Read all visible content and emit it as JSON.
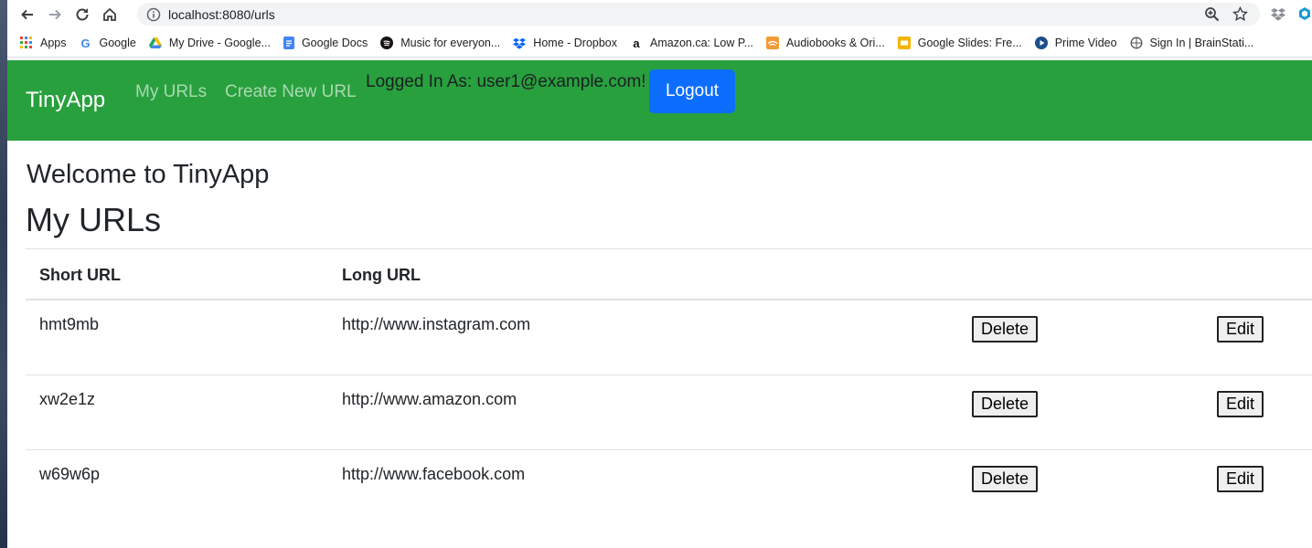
{
  "browser": {
    "url": "localhost:8080/urls",
    "bookmarks": [
      {
        "label": "Apps",
        "icon": "apps-grid-icon",
        "color": "#4285f4"
      },
      {
        "label": "Google",
        "icon": "google-icon",
        "color": "#4285f4"
      },
      {
        "label": "My Drive - Google...",
        "icon": "google-drive-icon",
        "color": "#1fa463"
      },
      {
        "label": "Google Docs",
        "icon": "google-docs-icon",
        "color": "#4285f4"
      },
      {
        "label": "Music for everyon...",
        "icon": "spotify-icon",
        "color": "#191414"
      },
      {
        "label": "Home - Dropbox",
        "icon": "dropbox-icon",
        "color": "#0061ff"
      },
      {
        "label": "Amazon.ca: Low P...",
        "icon": "amazon-icon",
        "color": "#111111"
      },
      {
        "label": "Audiobooks & Ori...",
        "icon": "audible-icon",
        "color": "#f29a36"
      },
      {
        "label": "Google Slides: Fre...",
        "icon": "google-slides-icon",
        "color": "#f4b400"
      },
      {
        "label": "Prime Video",
        "icon": "prime-video-icon",
        "color": "#1b4f8a"
      },
      {
        "label": "Sign In | BrainStati...",
        "icon": "brainstation-icon",
        "color": "#555555"
      }
    ]
  },
  "navbar": {
    "brand": "TinyApp",
    "links": [
      "My URLs",
      "Create New URL"
    ],
    "logged_in_text": "Logged In As: user1@example.com!",
    "logout_label": "Logout",
    "bg_color": "#28a03e"
  },
  "content": {
    "welcome": "Welcome to TinyApp",
    "title": "My URLs",
    "table": {
      "headers": [
        "Short URL",
        "Long URL"
      ],
      "rows": [
        {
          "short": "hmt9mb",
          "long": "http://www.instagram.com",
          "delete_label": "Delete",
          "edit_label": "Edit"
        },
        {
          "short": "xw2e1z",
          "long": "http://www.amazon.com",
          "delete_label": "Delete",
          "edit_label": "Edit"
        },
        {
          "short": "w69w6p",
          "long": "http://www.facebook.com",
          "delete_label": "Delete",
          "edit_label": "Edit"
        }
      ]
    }
  }
}
